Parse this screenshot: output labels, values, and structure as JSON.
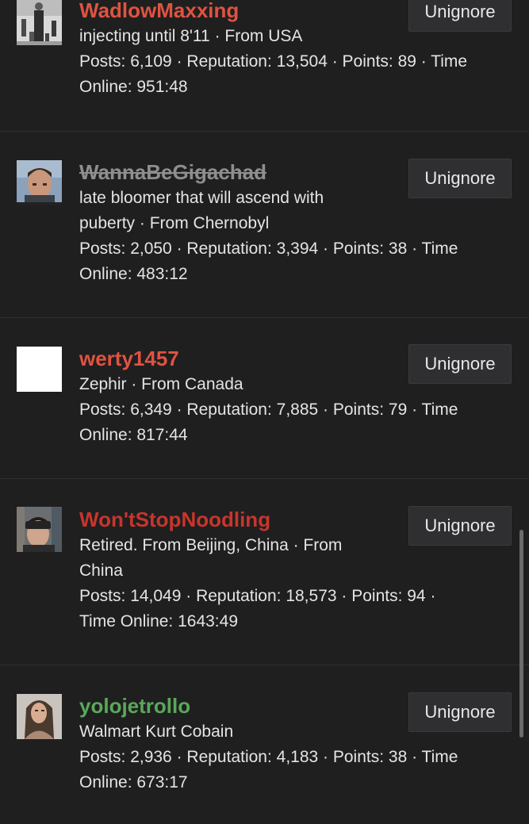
{
  "users": [
    {
      "username": "WadlowMaxxing",
      "color": "#e0533f",
      "banned": false,
      "avatar": "avatar-photo-tall-man",
      "lines": [
        "injecting until 8'11 · From USA",
        "Posts: 6,109 · Reputation: 13,504 · Points: 89 · Time",
        "Online: 951:48"
      ],
      "button": "Unignore"
    },
    {
      "username": "WannaBeGigachad",
      "color": "#8e8e8e",
      "banned": true,
      "avatar": "avatar-photo-face",
      "lines": [
        "late bloomer that will ascend with",
        "puberty · From Chernobyl",
        "Posts: 2,050 · Reputation: 3,394 · Points: 38 · Time",
        "Online: 483:12"
      ],
      "button": "Unignore"
    },
    {
      "username": "werty1457",
      "color": "#e0533f",
      "banned": false,
      "avatar": "avatar-blank",
      "lines": [
        "Zephir · From Canada",
        "Posts: 6,349 · Reputation: 7,885 · Points: 79 · Time",
        "Online: 817:44"
      ],
      "button": "Unignore"
    },
    {
      "username": "Won'tStopNoodling",
      "color": "#c9352b",
      "banned": false,
      "avatar": "avatar-photo-beanie",
      "lines": [
        "Retired. From Beijing, China · From",
        "China",
        "Posts: 14,049 · Reputation: 18,573 · Points: 94 ·",
        "Time Online: 1643:49"
      ],
      "button": "Unignore"
    },
    {
      "username": "yolojetrollo",
      "color": "#5aa85a",
      "banned": false,
      "avatar": "avatar-photo-woman",
      "lines": [
        "Walmart Kurt Cobain",
        "Posts: 2,936 · Reputation: 4,183 · Points: 38 · Time",
        "Online: 673:17"
      ],
      "button": "Unignore"
    }
  ]
}
